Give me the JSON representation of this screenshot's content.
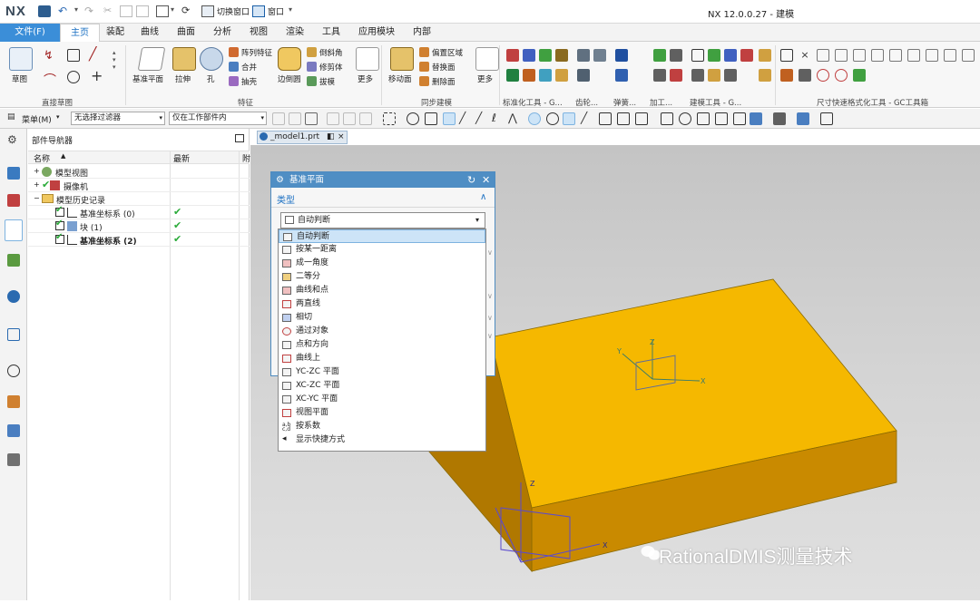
{
  "window": {
    "logo": "NX",
    "title": "NX 12.0.0.27 - 建模",
    "switch_window": "切换窗口",
    "window_menu": "窗口"
  },
  "tabs": [
    "文件(F)",
    "主页",
    "装配",
    "曲线",
    "曲面",
    "分析",
    "视图",
    "渲染",
    "工具",
    "应用模块",
    "内部"
  ],
  "active_tab": "主页",
  "ribbon": {
    "sketch": "草图",
    "datum_plane": "基准平面",
    "extrude": "拉伸",
    "hole": "孔",
    "pattern_feature": "阵列特征",
    "unite": "合并",
    "shell": "抽壳",
    "edge_blend": "边倒圆",
    "chamfer": "倒斜角",
    "trim_body": "修剪体",
    "draft": "拔模",
    "more1": "更多",
    "move_face": "移动面",
    "offset_region": "偏置区域",
    "replace_face": "替换面",
    "delete_face": "删除面",
    "more2": "更多",
    "groups": {
      "direct_sketch": "直接草图",
      "feature": "特征",
      "sync_modeling": "同步建模",
      "std_tools": "标准化工具 - G...",
      "gear": "齿轮...",
      "spring": "弹簧...",
      "machining": "加工...",
      "modeling_tools": "建模工具 - G...",
      "dim_tools": "尺寸快速格式化工具 - GC工具箱"
    }
  },
  "filterbar": {
    "menu": "菜单(M)",
    "filter": "无选择过滤器",
    "scope": "仅在工作部件内"
  },
  "navigator": {
    "title": "部件导航器",
    "col_name": "名称",
    "col_latest": "最新",
    "col_extra": "附",
    "rows": [
      {
        "label": "模型视图",
        "latest": ""
      },
      {
        "label": "摄像机",
        "latest": ""
      },
      {
        "label": "模型历史记录",
        "latest": ""
      },
      {
        "label": "基准坐标系 (0)",
        "latest": "✔"
      },
      {
        "label": "块 (1)",
        "latest": "✔"
      },
      {
        "label": "基准坐标系 (2)",
        "latest": "✔"
      }
    ]
  },
  "doc_tab": "_model1.prt",
  "dialog": {
    "title": "基准平面",
    "section": "类型",
    "selected_type": "自动判断",
    "types": [
      "自动判断",
      "按某一距离",
      "成一角度",
      "二等分",
      "曲线和点",
      "两直线",
      "相切",
      "通过对象",
      "点和方向",
      "曲线上",
      "YC-ZC 平面",
      "XC-ZC 平面",
      "XC-YC 平面",
      "视图平面",
      "按系数",
      "显示快捷方式"
    ]
  },
  "viewport_labels": {
    "z": "Z",
    "x": "X",
    "y": "Y"
  },
  "watermark": "RationalDMIS测量技术",
  "colors": {
    "accent": "#3b8ed8",
    "block": "#f5b800",
    "block_side": "#c98a00",
    "check": "#2bab3a"
  }
}
